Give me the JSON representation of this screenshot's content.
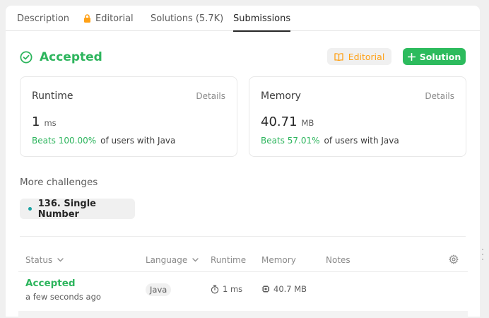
{
  "tabs": [
    {
      "label": "Description"
    },
    {
      "label": "Editorial",
      "icon": "lock-icon"
    },
    {
      "label": "Solutions (5.7K)"
    },
    {
      "label": "Submissions"
    }
  ],
  "result": {
    "status": "Accepted"
  },
  "buttons": {
    "editorial": "Editorial",
    "solution": "Solution"
  },
  "runtime": {
    "title": "Runtime",
    "details": "Details",
    "value": "1",
    "unit": "ms",
    "beats": "Beats 100.00%",
    "beats_suffix": "of users with Java"
  },
  "memory": {
    "title": "Memory",
    "details": "Details",
    "value": "40.71",
    "unit": "MB",
    "beats": "Beats 57.01%",
    "beats_suffix": "of users with Java"
  },
  "more_challenges": {
    "title": "More challenges",
    "items": [
      {
        "label": "136. Single Number"
      }
    ]
  },
  "table": {
    "headers": {
      "status": "Status",
      "language": "Language",
      "runtime": "Runtime",
      "memory": "Memory",
      "notes": "Notes"
    },
    "rows": [
      {
        "status": "Accepted",
        "time": "a few seconds ago",
        "language": "Java",
        "runtime": "1 ms",
        "memory": "40.7 MB",
        "notes": ""
      }
    ]
  },
  "colors": {
    "accent_green": "#2cbb5d",
    "editorial_orange": "#ffa116",
    "teal_dot": "#1aa3a3"
  }
}
